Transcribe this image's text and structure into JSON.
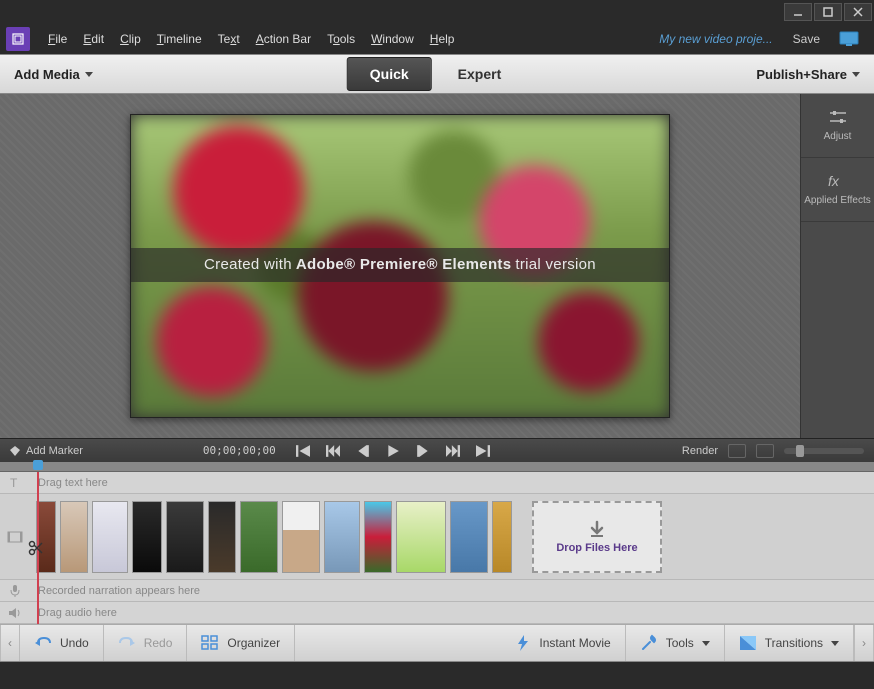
{
  "menu": {
    "items": [
      "File",
      "Edit",
      "Clip",
      "Timeline",
      "Text",
      "Action Bar",
      "Tools",
      "Window",
      "Help"
    ]
  },
  "project_name": "My new video proje...",
  "save_label": "Save",
  "modebar": {
    "add_media": "Add Media",
    "quick": "Quick",
    "expert": "Expert",
    "publish": "Publish+Share"
  },
  "watermark": {
    "prefix": "Created with",
    "brand": "Adobe® Premiere® Elements",
    "suffix": "trial version"
  },
  "side": {
    "adjust": "Adjust",
    "applied": "Applied Effects"
  },
  "playbar": {
    "add_marker": "Add Marker",
    "timecode": "00;00;00;00",
    "render": "Render"
  },
  "tracks": {
    "text_placeholder": "Drag text here",
    "narration_placeholder": "Recorded narration appears here",
    "audio_placeholder": "Drag audio here",
    "drop_files": "Drop Files Here"
  },
  "bottom": {
    "undo": "Undo",
    "redo": "Redo",
    "organizer": "Organizer",
    "instant_movie": "Instant Movie",
    "tools": "Tools",
    "transitions": "Transitions"
  }
}
